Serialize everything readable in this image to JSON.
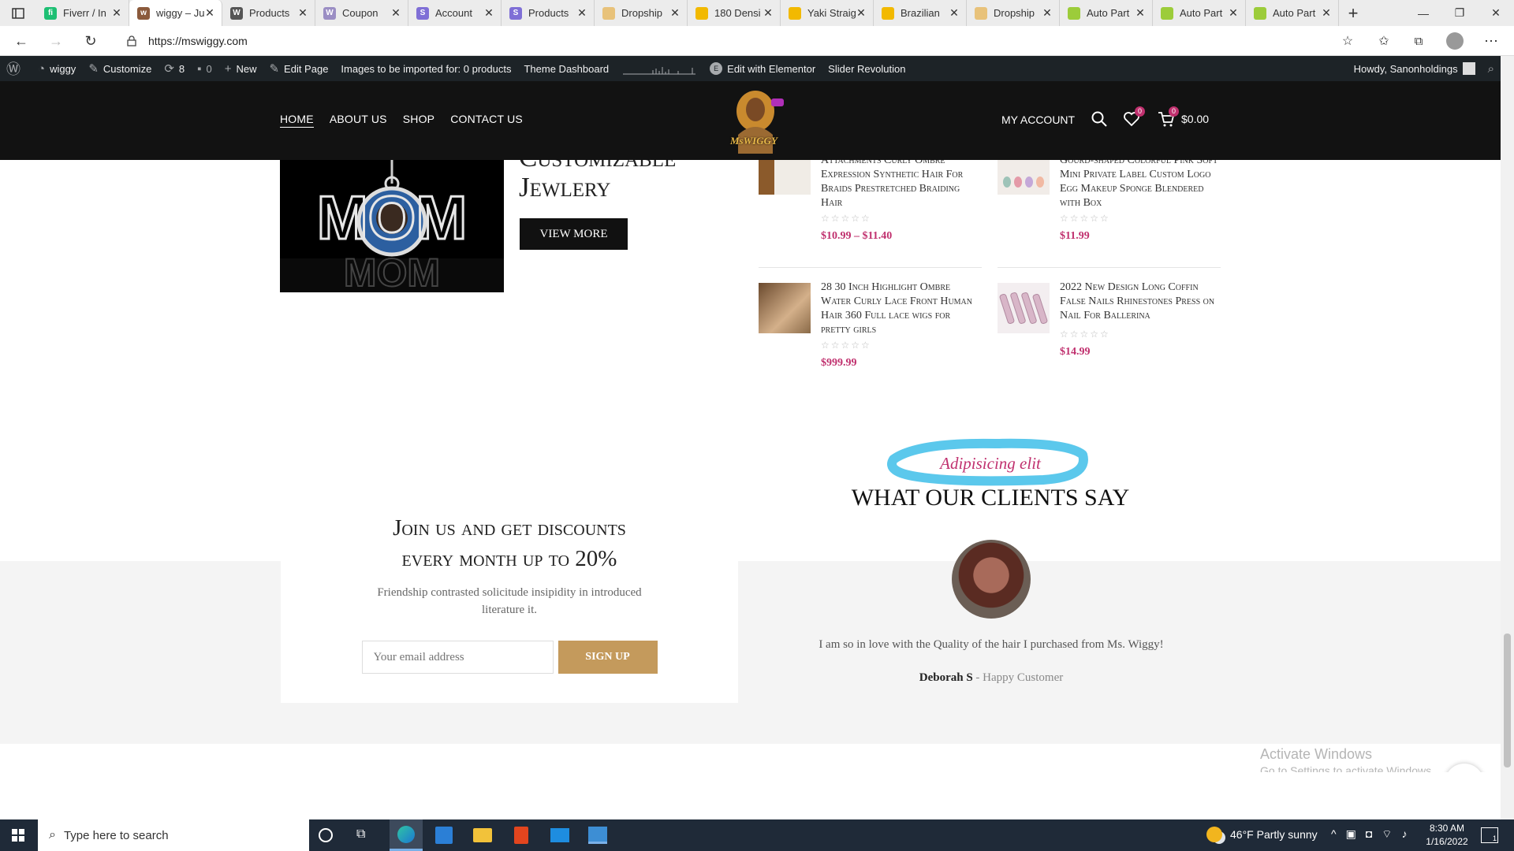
{
  "browser": {
    "tabs": [
      {
        "label": "Fiverr / In",
        "fav_color": "#1dbf73",
        "fav_text": "fi"
      },
      {
        "label": "wiggy – Ju",
        "fav_color": "#8b5a3c",
        "fav_text": "w",
        "active": true
      },
      {
        "label": "Products",
        "fav_color": "#555",
        "fav_text": "W"
      },
      {
        "label": "Coupon",
        "fav_color": "#9b8ec4",
        "fav_text": "W"
      },
      {
        "label": "Account",
        "fav_color": "#7f6fd6",
        "fav_text": "S"
      },
      {
        "label": "Products",
        "fav_color": "#7f6fd6",
        "fav_text": "S"
      },
      {
        "label": "Dropship",
        "fav_color": "#e8c27a",
        "fav_text": ""
      },
      {
        "label": "180 Densi",
        "fav_color": "#f2b900",
        "fav_text": ""
      },
      {
        "label": "Yaki Straig",
        "fav_color": "#f2b900",
        "fav_text": ""
      },
      {
        "label": "Brazilian",
        "fav_color": "#f2b900",
        "fav_text": ""
      },
      {
        "label": "Dropship",
        "fav_color": "#e8c27a",
        "fav_text": ""
      },
      {
        "label": "Auto Part",
        "fav_color": "#9ccc3a",
        "fav_text": ""
      },
      {
        "label": "Auto Part",
        "fav_color": "#9ccc3a",
        "fav_text": ""
      },
      {
        "label": "Auto Part",
        "fav_color": "#9ccc3a",
        "fav_text": ""
      }
    ],
    "url": "https://mswiggy.com"
  },
  "wp_admin_bar": {
    "site_name": "wiggy",
    "customize": "Customize",
    "updates_count": "8",
    "comments_count": "0",
    "new": "New",
    "edit_page": "Edit Page",
    "import_notice": "Images to be imported for: 0 products",
    "theme_dashboard": "Theme Dashboard",
    "elementor": "Edit with Elementor",
    "slider": "Slider Revolution",
    "howdy": "Howdy, Sanonholdings"
  },
  "header": {
    "nav": [
      "HOME",
      "ABOUT US",
      "SHOP",
      "CONTACT US"
    ],
    "logo_text": "MsWIGGY",
    "my_account": "MY ACCOUNT",
    "wishlist_count": "0",
    "cart_count": "0",
    "cart_total": "$0.00"
  },
  "promo": {
    "title_line1": "Customizable",
    "title_line2": "Jewlery",
    "button": "VIEW MORE",
    "image_text": "MOM"
  },
  "products": [
    {
      "title": "Attachments Curly Ombre Expression Synthetic Hair For Braids Prestretched Braiding Hair",
      "price": "$10.99 – $11.40"
    },
    {
      "title": "Gourd-shaped Colorful Pink Soft Mini Private Label Custom Logo Egg Makeup Sponge Blendered with Box",
      "price": "$11.99"
    },
    {
      "title": "28 30 Inch Highlight Ombre Water Curly Lace Front Human Hair 360 Full lace wigs for pretty girls",
      "price": "$999.99"
    },
    {
      "title": "2022 New Design Long Coffin False Nails Rhinestones Press on Nail For Ballerina",
      "price": "$14.99"
    }
  ],
  "stars": "☆☆☆☆☆",
  "newsletter": {
    "title_line1": "Join us and get discounts",
    "title_line2": "every month up to 20%",
    "subtitle": "Friendship contrasted solicitude insipidity in introduced literature it.",
    "email_placeholder": "Your email address",
    "button": "SIGN UP"
  },
  "testimonials": {
    "tagline": "Adipisicing elit",
    "heading": "WHAT OUR CLIENTS SAY",
    "quote": "I am so in love with the Quality of the hair I purchased from Ms. Wiggy!",
    "author": "Deborah S",
    "role": "- Happy Customer"
  },
  "watermark": {
    "line1": "Activate Windows",
    "line2": "Go to Settings to activate Windows."
  },
  "taskbar": {
    "search_placeholder": "Type here to search",
    "weather": "46°F  Partly sunny",
    "time": "8:30 AM",
    "date": "1/16/2022",
    "notification_count": "1"
  },
  "colors": {
    "accent_pink": "#c0306e",
    "header_bg": "#121212",
    "signup_btn": "#c49a5c",
    "highlight": "#5bc8ec"
  }
}
